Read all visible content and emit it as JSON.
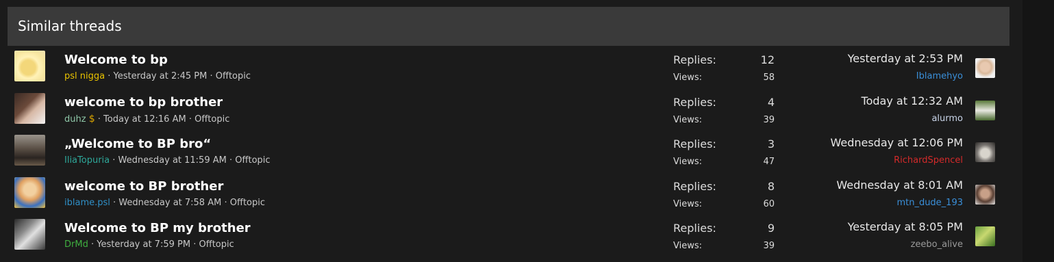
{
  "header": {
    "title": "Similar threads"
  },
  "threads": [
    {
      "title": "Welcome to bp",
      "author": "psl nigga",
      "author_color": "#e8c200",
      "posted": "Yesterday at 2:45 PM",
      "forum": "Offtopic",
      "replies_label": "Replies:",
      "replies": "12",
      "views_label": "Views:",
      "views": "58",
      "last_date": "Yesterday at 2:53 PM",
      "last_user": "Iblamehyo",
      "last_user_color": "#3a8fd9"
    },
    {
      "title": "welcome to bp brother",
      "author": "duhz",
      "author_badge": "$",
      "author_color": "#8fc7a8",
      "posted": "Today at 12:16 AM",
      "forum": "Offtopic",
      "replies_label": "Replies:",
      "replies": "4",
      "views_label": "Views:",
      "views": "39",
      "last_date": "Today at 12:32 AM",
      "last_user": "alurmo",
      "last_user_color": "#c8d4e8"
    },
    {
      "title": "„Welcome to BP bro“",
      "author": "IliaTopuria",
      "author_color": "#2ea89a",
      "posted": "Wednesday at 11:59 AM",
      "forum": "Offtopic",
      "replies_label": "Replies:",
      "replies": "3",
      "views_label": "Views:",
      "views": "47",
      "last_date": "Wednesday at 12:06 PM",
      "last_user": "RichardSpencel",
      "last_user_color": "#d42a2a"
    },
    {
      "title": "welcome to BP brother",
      "author": "iblame.psl",
      "author_color": "#2f8fc7",
      "posted": "Wednesday at 7:58 AM",
      "forum": "Offtopic",
      "replies_label": "Replies:",
      "replies": "8",
      "views_label": "Views:",
      "views": "60",
      "last_date": "Wednesday at 8:01 AM",
      "last_user": "mtn_dude_193",
      "last_user_color": "#3a8fd9"
    },
    {
      "title": "Welcome to BP my brother",
      "author": "DrMd",
      "author_color": "#3fae3f",
      "posted": "Yesterday at 7:59 PM",
      "forum": "Offtopic",
      "replies_label": "Replies:",
      "replies": "9",
      "views_label": "Views:",
      "views": "39",
      "last_date": "Yesterday at 8:05 PM",
      "last_user": "zeebo_alive",
      "last_user_color": "#9a9a9a"
    }
  ],
  "separator": "·"
}
